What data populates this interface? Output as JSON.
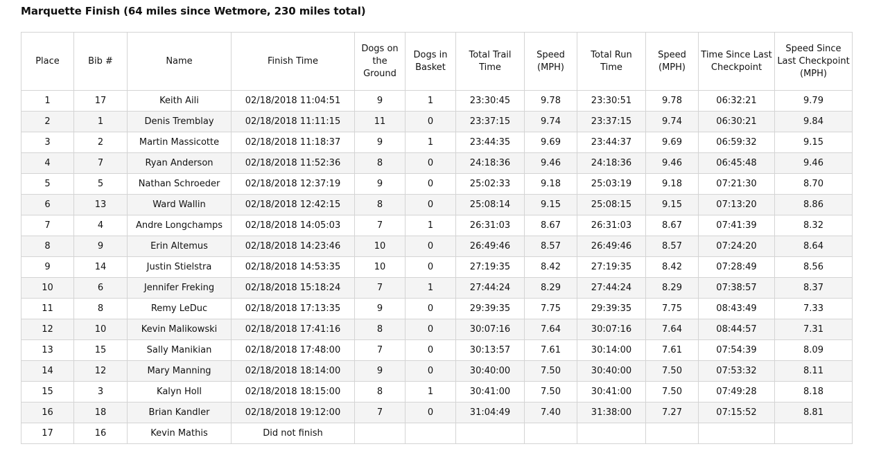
{
  "page": {
    "title": "Marquette Finish (64 miles since Wetmore, 230 miles total)"
  },
  "table": {
    "headers": [
      "Place",
      "Bib #",
      "Name",
      "Finish Time",
      "Dogs on the Ground",
      "Dogs in Basket",
      "Total Trail Time",
      "Speed (MPH)",
      "Total Run Time",
      "Speed (MPH)",
      "Time Since Last Checkpoint",
      "Speed Since Last Checkpoint (MPH)"
    ],
    "rows": [
      [
        "1",
        "17",
        "Keith Aili",
        "02/18/2018 11:04:51",
        "9",
        "1",
        "23:30:45",
        "9.78",
        "23:30:51",
        "9.78",
        "06:32:21",
        "9.79"
      ],
      [
        "2",
        "1",
        "Denis Tremblay",
        "02/18/2018 11:11:15",
        "11",
        "0",
        "23:37:15",
        "9.74",
        "23:37:15",
        "9.74",
        "06:30:21",
        "9.84"
      ],
      [
        "3",
        "2",
        "Martin Massicotte",
        "02/18/2018 11:18:37",
        "9",
        "1",
        "23:44:35",
        "9.69",
        "23:44:37",
        "9.69",
        "06:59:32",
        "9.15"
      ],
      [
        "4",
        "7",
        "Ryan Anderson",
        "02/18/2018 11:52:36",
        "8",
        "0",
        "24:18:36",
        "9.46",
        "24:18:36",
        "9.46",
        "06:45:48",
        "9.46"
      ],
      [
        "5",
        "5",
        "Nathan Schroeder",
        "02/18/2018 12:37:19",
        "9",
        "0",
        "25:02:33",
        "9.18",
        "25:03:19",
        "9.18",
        "07:21:30",
        "8.70"
      ],
      [
        "6",
        "13",
        "Ward Wallin",
        "02/18/2018 12:42:15",
        "8",
        "0",
        "25:08:14",
        "9.15",
        "25:08:15",
        "9.15",
        "07:13:20",
        "8.86"
      ],
      [
        "7",
        "4",
        "Andre Longchamps",
        "02/18/2018 14:05:03",
        "7",
        "1",
        "26:31:03",
        "8.67",
        "26:31:03",
        "8.67",
        "07:41:39",
        "8.32"
      ],
      [
        "8",
        "9",
        "Erin Altemus",
        "02/18/2018 14:23:46",
        "10",
        "0",
        "26:49:46",
        "8.57",
        "26:49:46",
        "8.57",
        "07:24:20",
        "8.64"
      ],
      [
        "9",
        "14",
        "Justin Stielstra",
        "02/18/2018 14:53:35",
        "10",
        "0",
        "27:19:35",
        "8.42",
        "27:19:35",
        "8.42",
        "07:28:49",
        "8.56"
      ],
      [
        "10",
        "6",
        "Jennifer Freking",
        "02/18/2018 15:18:24",
        "7",
        "1",
        "27:44:24",
        "8.29",
        "27:44:24",
        "8.29",
        "07:38:57",
        "8.37"
      ],
      [
        "11",
        "8",
        "Remy LeDuc",
        "02/18/2018 17:13:35",
        "9",
        "0",
        "29:39:35",
        "7.75",
        "29:39:35",
        "7.75",
        "08:43:49",
        "7.33"
      ],
      [
        "12",
        "10",
        "Kevin Malikowski",
        "02/18/2018 17:41:16",
        "8",
        "0",
        "30:07:16",
        "7.64",
        "30:07:16",
        "7.64",
        "08:44:57",
        "7.31"
      ],
      [
        "13",
        "15",
        "Sally Manikian",
        "02/18/2018 17:48:00",
        "7",
        "0",
        "30:13:57",
        "7.61",
        "30:14:00",
        "7.61",
        "07:54:39",
        "8.09"
      ],
      [
        "14",
        "12",
        "Mary Manning",
        "02/18/2018 18:14:00",
        "9",
        "0",
        "30:40:00",
        "7.50",
        "30:40:00",
        "7.50",
        "07:53:32",
        "8.11"
      ],
      [
        "15",
        "3",
        "Kalyn Holl",
        "02/18/2018 18:15:00",
        "8",
        "1",
        "30:41:00",
        "7.50",
        "30:41:00",
        "7.50",
        "07:49:28",
        "8.18"
      ],
      [
        "16",
        "18",
        "Brian Kandler",
        "02/18/2018 19:12:00",
        "7",
        "0",
        "31:04:49",
        "7.40",
        "31:38:00",
        "7.27",
        "07:15:52",
        "8.81"
      ],
      [
        "17",
        "16",
        "Kevin Mathis",
        "Did not finish",
        "",
        "",
        "",
        "",
        "",
        "",
        "",
        ""
      ]
    ]
  }
}
